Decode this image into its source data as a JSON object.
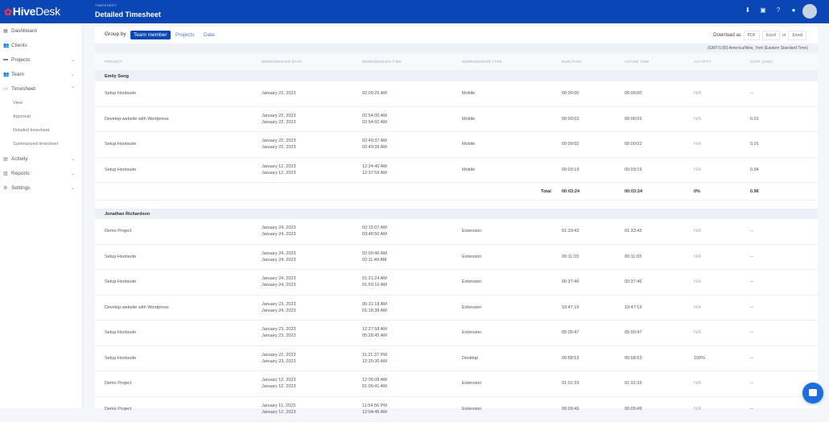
{
  "app": {
    "logo_mark": "Hive",
    "logo_rest": "Desk",
    "breadcrumb": "TIMESHEET",
    "title": "Detailed Timesheet"
  },
  "topbar_icons": [
    "download-icon",
    "map-icon",
    "help-icon",
    "gear-icon"
  ],
  "sidebar": {
    "items": [
      {
        "label": "Dashboard",
        "icon": "▦",
        "chev": ""
      },
      {
        "label": "Clients",
        "icon": "👥",
        "chev": ""
      },
      {
        "label": "Projects",
        "icon": "▬",
        "chev": "⌄"
      },
      {
        "label": "Team",
        "icon": "👥",
        "chev": "⌄"
      },
      {
        "label": "Timesheet",
        "icon": "▭",
        "chev": "⌃"
      }
    ],
    "sub": [
      "View",
      "Approval",
      "Detailed timesheet",
      "Summarized timesheet"
    ],
    "items2": [
      {
        "label": "Activity",
        "icon": "▤",
        "chev": "⌄"
      },
      {
        "label": "Reports",
        "icon": "▥",
        "chev": "⌄"
      },
      {
        "label": "Settings",
        "icon": "⚙",
        "chev": "⌄"
      }
    ]
  },
  "toolbar": {
    "group_by": "Group by",
    "team_member": "Team member",
    "projects": "Projects",
    "date": "Date",
    "download_as": "Download as",
    "pdf": "PDF",
    "excel": "Excel",
    "or": "or",
    "email": "Email"
  },
  "timezone": "(GMT-5:00) America/New_York (Eastern Standard Time)",
  "columns": [
    "PROJECT",
    "WORKSESSION DATE",
    "WORKSESSION TIME",
    "WORKSESSION TYPE",
    "DURATION",
    "ACTIVE TIME",
    "ACTIVITY",
    "COST (USD)"
  ],
  "groups": [
    {
      "name": "Emily Song",
      "rows": [
        {
          "project": "Setup Hootsuite",
          "date1": "January 22, 2023",
          "date2": "",
          "time1": "02:09:25 AM",
          "time2": "",
          "type": "Mobile",
          "duration": "00:00:00",
          "active": "00:00:00",
          "activity": "N/A",
          "cost": "--"
        },
        {
          "project": "Develop website with Wordpress",
          "date1": "January 22, 2023",
          "date2": "January 22, 2023",
          "time1": "02:54:00 AM",
          "time2": "02:54:02 AM",
          "type": "Mobile",
          "duration": "00:00:03",
          "active": "00:00:03",
          "activity": "N/A",
          "cost": "0.01"
        },
        {
          "project": "Setup Hootsuite",
          "date1": "January 22, 2023",
          "date2": "January 22, 2023",
          "time1": "02:49:37 AM",
          "time2": "02:49:39 AM",
          "type": "Mobile",
          "duration": "00:00:02",
          "active": "00:00:02",
          "activity": "N/A",
          "cost": "0.01"
        },
        {
          "project": "Setup Hootsuite",
          "date1": "January 12, 2023",
          "date2": "January 12, 2023",
          "time1": "12:34:40 AM",
          "time2": "12:37:59 AM",
          "type": "Mobile",
          "duration": "00:03:19",
          "active": "00:03:19",
          "activity": "N/A",
          "cost": "0.94"
        }
      ],
      "total": {
        "label": "Total",
        "duration": "00:03:24",
        "active": "00:03:24",
        "activity": "0%",
        "cost": "0.96"
      }
    },
    {
      "name": "Jonathan Richardson",
      "rows": [
        {
          "project": "Demo Project",
          "date1": "January 24, 2023",
          "date2": "January 24, 2023",
          "time1": "02:15:07 AM",
          "time2": "03:48:50 AM",
          "type": "Extension",
          "duration": "01:33:43",
          "active": "01:33:43",
          "activity": "N/A",
          "cost": "--"
        },
        {
          "project": "Setup Hootsuite",
          "date1": "January 24, 2023",
          "date2": "January 24, 2023",
          "time1": "02:00:46 AM",
          "time2": "02:11:49 AM",
          "type": "Extension",
          "duration": "00:11:03",
          "active": "00:11:03",
          "activity": "N/A",
          "cost": "--"
        },
        {
          "project": "Setup Hootsuite",
          "date1": "January 24, 2023",
          "date2": "January 24, 2023",
          "time1": "01:21:24 AM",
          "time2": "01:59:10 AM",
          "type": "Extension",
          "duration": "00:37:46",
          "active": "00:37:46",
          "activity": "N/A",
          "cost": "--"
        },
        {
          "project": "Develop website with Wordpress",
          "date1": "January 23, 2023",
          "date2": "January 24, 2023",
          "time1": "05:31:18 AM",
          "time2": "01:18:38 AM",
          "type": "Extension",
          "duration": "19:47:19",
          "active": "19:47:19",
          "activity": "N/A",
          "cost": "--"
        },
        {
          "project": "Setup Hootsuite",
          "date1": "January 23, 2023",
          "date2": "January 23, 2023",
          "time1": "12:27:58 AM",
          "time2": "05:28:45 AM",
          "type": "Extension",
          "duration": "05:00:47",
          "active": "05:00:47",
          "activity": "N/A",
          "cost": "--"
        },
        {
          "project": "Setup Hootsuite",
          "date1": "January 22, 2023",
          "date2": "January 23, 2023",
          "time1": "11:21:37 PM",
          "time2": "12:20:30 AM",
          "type": "Desktop",
          "duration": "00:58:53",
          "active": "00:58:53",
          "activity": "100%",
          "cost": "--"
        },
        {
          "project": "Demo Project",
          "date1": "January 12, 2023",
          "date2": "January 12, 2023",
          "time1": "12:05:08 AM",
          "time2": "01:06:41 AM",
          "type": "Extension",
          "duration": "01:01:33",
          "active": "01:01:33",
          "activity": "N/A",
          "cost": "--"
        },
        {
          "project": "Demo Project",
          "date1": "January 11, 2023",
          "date2": "January 12, 2023",
          "time1": "11:54:56 PM",
          "time2": "12:04:45 AM",
          "type": "Extension",
          "duration": "00:09:49",
          "active": "00:09:49",
          "activity": "N/A",
          "cost": "--"
        }
      ]
    }
  ]
}
